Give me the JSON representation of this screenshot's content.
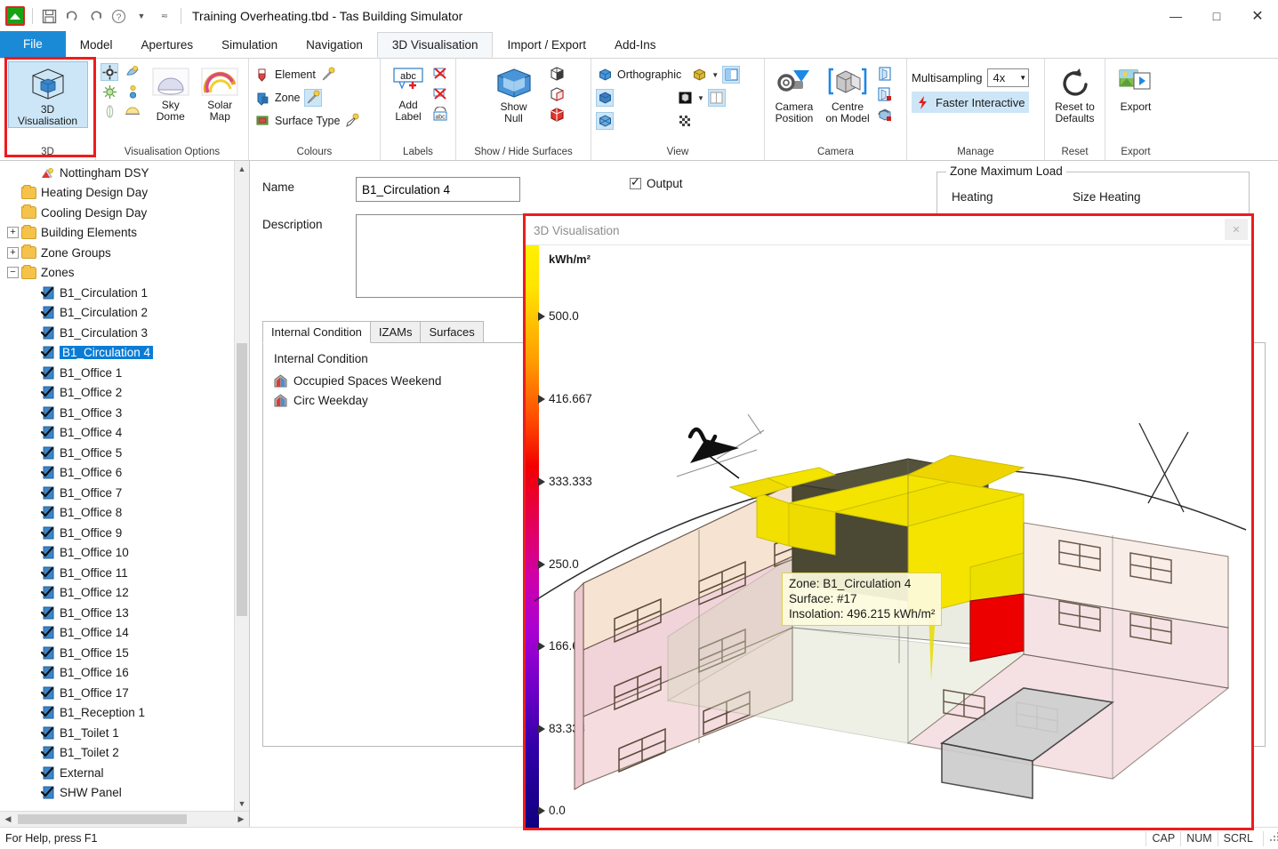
{
  "titlebar": {
    "app_icon": "home-green-icon",
    "quick_access": [
      {
        "name": "save-icon",
        "glyph": "💾"
      },
      {
        "name": "undo-icon",
        "glyph": "↶"
      },
      {
        "name": "redo-icon",
        "glyph": "↷"
      },
      {
        "name": "help-icon",
        "glyph": "?"
      },
      {
        "name": "quick-access-dropdown-icon",
        "glyph": "▾"
      },
      {
        "name": "customize-toolbar-icon",
        "glyph": "≡"
      }
    ],
    "title": "Training Overheating.tbd - Tas Building Simulator",
    "minimize": "—",
    "maximize": "□",
    "close": "✕"
  },
  "tabs": [
    {
      "label": "File",
      "type": "file"
    },
    {
      "label": "Model",
      "type": "normal"
    },
    {
      "label": "Apertures",
      "type": "normal"
    },
    {
      "label": "Simulation",
      "type": "normal"
    },
    {
      "label": "Navigation",
      "type": "normal"
    },
    {
      "label": "3D Visualisation",
      "type": "active"
    },
    {
      "label": "Import / Export",
      "type": "normal"
    },
    {
      "label": "Add-Ins",
      "type": "normal"
    }
  ],
  "ribbon": {
    "groups": [
      {
        "name": "3d",
        "label": "3D",
        "big_button": {
          "line1": "3D",
          "line2": "Visualisation",
          "icon": "cube-wireframe-icon",
          "selected": true
        }
      },
      {
        "name": "visualisation-options",
        "label": "Visualisation Options",
        "icons": [
          "sun-position-icon",
          "shadow-icon",
          "daylight-icon",
          "sun-path-icon",
          "solar-angle-icon",
          "horizon-icon"
        ],
        "buttons": [
          {
            "line1": "Sky",
            "line2": "Dome",
            "icon": "sky-dome-icon"
          },
          {
            "line1": "Solar",
            "line2": "Map",
            "icon": "solar-map-icon"
          }
        ]
      },
      {
        "name": "colours",
        "label": "Colours",
        "items": [
          {
            "label": "Element",
            "icon": "element-colour-icon",
            "brush": "brush-icon",
            "brush_selected": false
          },
          {
            "label": "Zone",
            "icon": "zone-colour-icon",
            "brush": "brush-icon",
            "brush_selected": true
          },
          {
            "label": "Surface Type",
            "icon": "surface-type-colour-icon",
            "brush": "brush-outline-icon",
            "brush_selected": false
          }
        ]
      },
      {
        "name": "labels",
        "label": "Labels",
        "big_button": {
          "line1": "Add",
          "line2": "Label",
          "icon": "abc-label-icon"
        },
        "icons": [
          "delete-label-icon",
          "delete-all-labels-icon",
          "label-settings-icon"
        ]
      },
      {
        "name": "show-hide-surfaces",
        "label": "Show / Hide Surfaces",
        "big_button": {
          "line1": "Show",
          "line2": "Null",
          "icon": "show-null-cube-icon"
        },
        "icons": [
          "hide-surface-icon",
          "show-surface-icon",
          "show-all-surfaces-icon"
        ]
      },
      {
        "name": "view",
        "label": "View",
        "checkbox_label": "Orthographic",
        "icons": [
          "orthographic-cube-icon",
          "perspective-cube-icon",
          "wireframe-cube-icon",
          "gold-cube-icon",
          "dark-cube-icon",
          "checker-transparency-icon",
          "split-view-icon",
          "dual-view-icon"
        ]
      },
      {
        "name": "camera",
        "label": "Camera",
        "buttons": [
          {
            "line1": "Camera",
            "line2": "Position",
            "icon": "camera-position-icon"
          },
          {
            "line1": "Centre",
            "line2": "on Model",
            "icon": "centre-on-model-icon"
          }
        ],
        "icons": [
          "save-camera-icon",
          "lock-camera-icon",
          "reset-camera-icon"
        ]
      },
      {
        "name": "manage",
        "label": "Manage",
        "multisampling_label": "Multisampling",
        "multisampling_value": "4x",
        "faster_interactive_label": "Faster Interactive",
        "faster_interactive_selected": true
      },
      {
        "name": "reset",
        "label": "Reset",
        "big_button": {
          "line1": "Reset to",
          "line2": "Defaults",
          "icon": "reset-arrow-icon"
        }
      },
      {
        "name": "export",
        "label": "Export",
        "big_button": {
          "line1": "Export",
          "line2": "",
          "icon": "export-image-icon"
        }
      }
    ]
  },
  "tree": {
    "items": [
      {
        "label": "Nottingham DSY",
        "depth": 2,
        "icon": "weather-icon",
        "expander": "none",
        "selected": false
      },
      {
        "label": "Heating Design Day",
        "depth": 1,
        "icon": "folder",
        "expander": "none",
        "selected": false
      },
      {
        "label": "Cooling Design Day",
        "depth": 1,
        "icon": "folder",
        "expander": "none",
        "selected": false
      },
      {
        "label": "Building Elements",
        "depth": 1,
        "icon": "folder",
        "expander": "plus",
        "selected": false
      },
      {
        "label": "Zone Groups",
        "depth": 1,
        "icon": "folder",
        "expander": "plus",
        "selected": false
      },
      {
        "label": "Zones",
        "depth": 1,
        "icon": "folder",
        "expander": "minus",
        "selected": false
      },
      {
        "label": "B1_Circulation 1",
        "depth": 2,
        "icon": "zone",
        "expander": "none",
        "selected": false
      },
      {
        "label": "B1_Circulation 2",
        "depth": 2,
        "icon": "zone",
        "expander": "none",
        "selected": false
      },
      {
        "label": "B1_Circulation 3",
        "depth": 2,
        "icon": "zone",
        "expander": "none",
        "selected": false
      },
      {
        "label": "B1_Circulation 4",
        "depth": 2,
        "icon": "zone",
        "expander": "none",
        "selected": true
      },
      {
        "label": "B1_Office 1",
        "depth": 2,
        "icon": "zone",
        "expander": "none",
        "selected": false
      },
      {
        "label": "B1_Office 2",
        "depth": 2,
        "icon": "zone",
        "expander": "none",
        "selected": false
      },
      {
        "label": "B1_Office 3",
        "depth": 2,
        "icon": "zone",
        "expander": "none",
        "selected": false
      },
      {
        "label": "B1_Office 4",
        "depth": 2,
        "icon": "zone",
        "expander": "none",
        "selected": false
      },
      {
        "label": "B1_Office 5",
        "depth": 2,
        "icon": "zone",
        "expander": "none",
        "selected": false
      },
      {
        "label": "B1_Office 6",
        "depth": 2,
        "icon": "zone",
        "expander": "none",
        "selected": false
      },
      {
        "label": "B1_Office 7",
        "depth": 2,
        "icon": "zone",
        "expander": "none",
        "selected": false
      },
      {
        "label": "B1_Office 8",
        "depth": 2,
        "icon": "zone",
        "expander": "none",
        "selected": false
      },
      {
        "label": "B1_Office 9",
        "depth": 2,
        "icon": "zone",
        "expander": "none",
        "selected": false
      },
      {
        "label": "B1_Office 10",
        "depth": 2,
        "icon": "zone",
        "expander": "none",
        "selected": false
      },
      {
        "label": "B1_Office 11",
        "depth": 2,
        "icon": "zone",
        "expander": "none",
        "selected": false
      },
      {
        "label": "B1_Office 12",
        "depth": 2,
        "icon": "zone",
        "expander": "none",
        "selected": false
      },
      {
        "label": "B1_Office 13",
        "depth": 2,
        "icon": "zone",
        "expander": "none",
        "selected": false
      },
      {
        "label": "B1_Office 14",
        "depth": 2,
        "icon": "zone",
        "expander": "none",
        "selected": false
      },
      {
        "label": "B1_Office 15",
        "depth": 2,
        "icon": "zone",
        "expander": "none",
        "selected": false
      },
      {
        "label": "B1_Office 16",
        "depth": 2,
        "icon": "zone",
        "expander": "none",
        "selected": false
      },
      {
        "label": "B1_Office 17",
        "depth": 2,
        "icon": "zone",
        "expander": "none",
        "selected": false
      },
      {
        "label": "B1_Reception 1",
        "depth": 2,
        "icon": "zone",
        "expander": "none",
        "selected": false
      },
      {
        "label": "B1_Toilet 1",
        "depth": 2,
        "icon": "zone",
        "expander": "none",
        "selected": false
      },
      {
        "label": "B1_Toilet 2",
        "depth": 2,
        "icon": "zone",
        "expander": "none",
        "selected": false
      },
      {
        "label": "External",
        "depth": 2,
        "icon": "zone",
        "expander": "none",
        "selected": false
      },
      {
        "label": "SHW Panel",
        "depth": 2,
        "icon": "zone",
        "expander": "none",
        "selected": false
      }
    ]
  },
  "form": {
    "name_label": "Name",
    "name_value": "B1_Circulation 4",
    "description_label": "Description",
    "description_value": "",
    "output_label": "Output",
    "output_checked": true,
    "zone_max_load_title": "Zone Maximum Load",
    "zone_max_load_col1": "Heating",
    "zone_max_load_col2": "Size Heating",
    "tabs": [
      {
        "label": "Internal Condition",
        "active": true
      },
      {
        "label": "IZAMs",
        "active": false
      },
      {
        "label": "Surfaces",
        "active": false
      }
    ],
    "internal_condition_heading": "Internal Condition",
    "internal_conditions": [
      {
        "label": "Occupied Spaces Weekend",
        "icon": "internal-condition-icon"
      },
      {
        "label": "Circ Weekday",
        "icon": "internal-condition-icon"
      }
    ]
  },
  "visualisation": {
    "panel_title": "3D Visualisation",
    "close_glyph": "✕",
    "legend_unit": "kWh/m²",
    "legend_ticks": [
      "500.0",
      "416.667",
      "333.333",
      "250.0",
      "166.667",
      "83.333",
      "0.0"
    ],
    "legend_colors": {
      "max": "#fff000",
      "mid_high": "#ff4a00",
      "mid": "#e3005a",
      "mid_low": "#aa00d2",
      "min": "#100080"
    },
    "tooltip": {
      "zone": "Zone: B1_Circulation 4",
      "surface": "Surface: #17",
      "insolation": "Insolation: 496.215 kWh/m²"
    },
    "north_arrow": "north-arrow-icon",
    "highlight_colour": "#ffee00",
    "selected_surface_colour": "#ee0000"
  },
  "status": {
    "help_text": "For Help, press F1",
    "indicators": [
      "CAP",
      "NUM",
      "SCRL"
    ]
  }
}
